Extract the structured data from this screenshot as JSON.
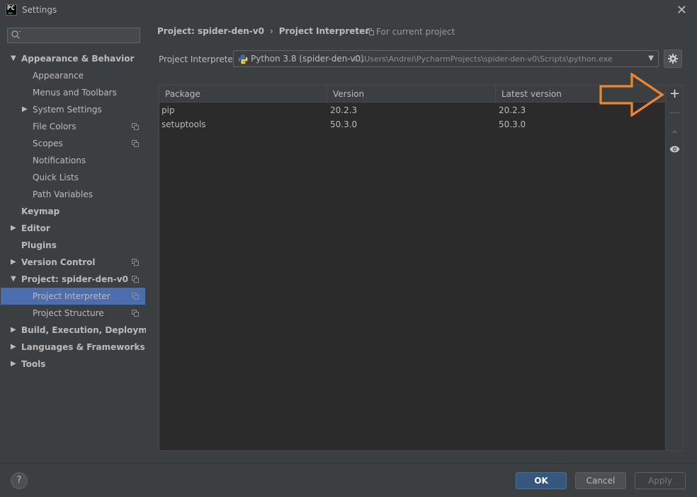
{
  "window": {
    "app_badge": "PC",
    "title": "Settings",
    "close_glyph": "✕"
  },
  "search": {
    "value": "",
    "placeholder": ""
  },
  "sidebar": {
    "items": [
      {
        "label": "Appearance & Behavior",
        "level": 0,
        "expanded": true,
        "has_arrow": true,
        "arrow": "▼",
        "copy_icon": false
      },
      {
        "label": "Appearance",
        "level": 1
      },
      {
        "label": "Menus and Toolbars",
        "level": 1
      },
      {
        "label": "System Settings",
        "level": 1,
        "has_arrow": true,
        "arrow": "▶"
      },
      {
        "label": "File Colors",
        "level": 1,
        "copy_icon": true
      },
      {
        "label": "Scopes",
        "level": 1,
        "copy_icon": true
      },
      {
        "label": "Notifications",
        "level": 1
      },
      {
        "label": "Quick Lists",
        "level": 1
      },
      {
        "label": "Path Variables",
        "level": 1
      },
      {
        "label": "Keymap",
        "level": 0
      },
      {
        "label": "Editor",
        "level": 0,
        "has_arrow": true,
        "arrow": "▶"
      },
      {
        "label": "Plugins",
        "level": 0
      },
      {
        "label": "Version Control",
        "level": 0,
        "has_arrow": true,
        "arrow": "▶",
        "copy_icon": true
      },
      {
        "label": "Project: spider-den-v0",
        "level": 0,
        "has_arrow": true,
        "arrow": "▼",
        "copy_icon": true
      },
      {
        "label": "Project Interpreter",
        "level": 1,
        "selected": true,
        "copy_icon": true
      },
      {
        "label": "Project Structure",
        "level": 1,
        "copy_icon": true
      },
      {
        "label": "Build, Execution, Deployment",
        "level": 0,
        "has_arrow": true,
        "arrow": "▶"
      },
      {
        "label": "Languages & Frameworks",
        "level": 0,
        "has_arrow": true,
        "arrow": "▶"
      },
      {
        "label": "Tools",
        "level": 0,
        "has_arrow": true,
        "arrow": "▶"
      }
    ]
  },
  "breadcrumb": {
    "project": "Project: spider-den-v0",
    "separator": "›",
    "page": "Project Interpreter",
    "scope_note": "For current project"
  },
  "interpreter": {
    "label": "Project Interpreter:",
    "name": "Python 3.8 (spider-den-v0)",
    "path": "C:\\Users\\Andrei\\PycharmProjects\\spider-den-v0\\Scripts\\python.exe",
    "dropdown_arrow": "▼"
  },
  "packages": {
    "columns": [
      "Package",
      "Version",
      "Latest version"
    ],
    "rows": [
      {
        "package": "pip",
        "version": "20.2.3",
        "latest": "20.2.3"
      },
      {
        "package": "setuptools",
        "version": "50.3.0",
        "latest": "50.3.0"
      }
    ],
    "tools": {
      "add": "+",
      "remove": "—"
    }
  },
  "footer": {
    "help": "?",
    "ok": "OK",
    "cancel": "Cancel",
    "apply": "Apply"
  },
  "colors": {
    "background": "#3c3f41",
    "table_bg": "#2b2b2b",
    "selection": "#4b6eaf",
    "ok_button": "#365880",
    "annotation_arrow": "#f0862c"
  },
  "icons": {
    "app": "pycharm-icon",
    "search": "search-icon",
    "copy": "copy-icon",
    "python": "python-icon",
    "gear": "gear-icon",
    "up": "up-arrow-icon",
    "eye": "eye-icon",
    "annotation": "orange-arrow-annotation"
  }
}
